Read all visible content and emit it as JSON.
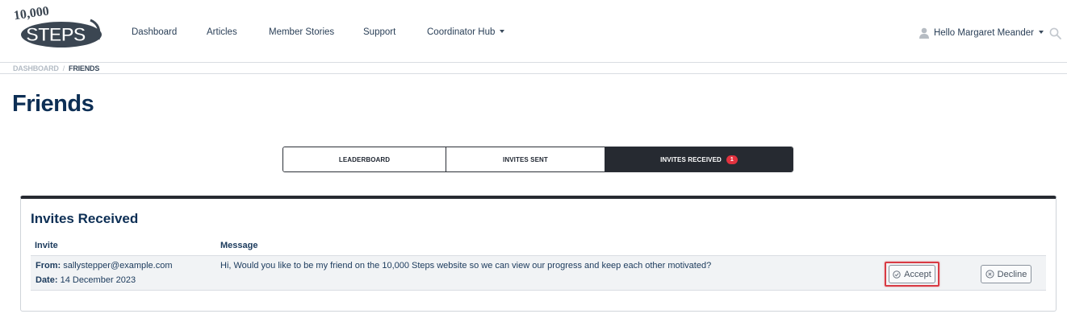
{
  "header": {
    "logo_text": "10,000 STEPS",
    "nav": [
      {
        "label": "Dashboard"
      },
      {
        "label": "Articles"
      },
      {
        "label": "Member Stories"
      },
      {
        "label": "Support"
      },
      {
        "label": "Coordinator Hub"
      }
    ],
    "user_greeting": "Hello Margaret Meander"
  },
  "breadcrumb": {
    "home": "DASHBOARD",
    "separator": "/",
    "current": "FRIENDS"
  },
  "page": {
    "title": "Friends"
  },
  "tabs": [
    {
      "label": "LEADERBOARD"
    },
    {
      "label": "INVITES SENT"
    },
    {
      "label": "INVITES RECEIVED",
      "badge": "1",
      "active": true
    }
  ],
  "invites": {
    "title": "Invites Received",
    "columns": {
      "invite": "Invite",
      "message": "Message"
    },
    "rows": [
      {
        "from_label": "From:",
        "from_value": "sallystepper@example.com",
        "date_label": "Date:",
        "date_value": "14 December 2023",
        "message": "Hi, Would you like to be my friend on the 10,000 Steps website so we can view our progress and keep each other motivated?",
        "accept_label": "Accept",
        "decline_label": "Decline"
      }
    ]
  },
  "colors": {
    "brand_navy": "#0d2f55",
    "tab_active": "#262a31",
    "badge_red": "#e2323f",
    "highlight_red": "#d83a43"
  }
}
